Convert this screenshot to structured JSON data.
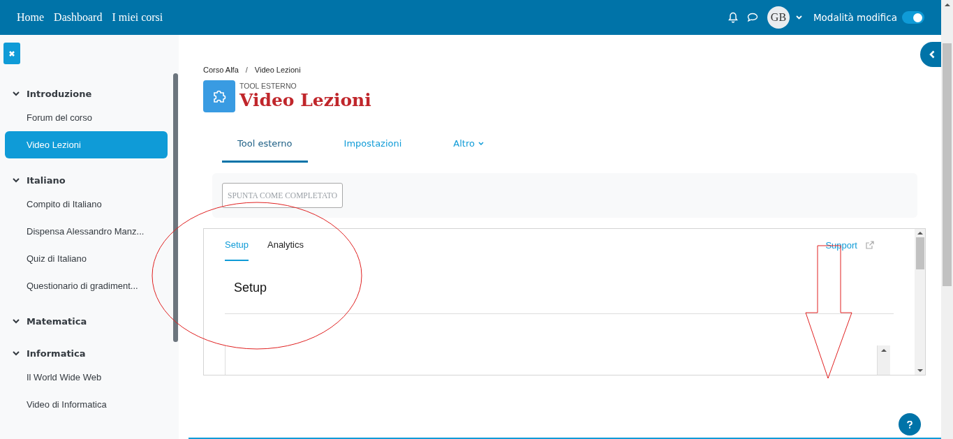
{
  "navbar": {
    "links": [
      {
        "label": "Home"
      },
      {
        "label": "Dashboard"
      },
      {
        "label": "I miei corsi"
      }
    ],
    "avatar": "GB",
    "edit_mode": {
      "label": "Modalità modifica",
      "on": true
    }
  },
  "sidebar": {
    "sections": [
      {
        "title": "Introduzione",
        "expanded": true,
        "items": [
          {
            "label": "Forum del corso",
            "selected": false
          },
          {
            "label": "Video Lezioni",
            "selected": true
          }
        ]
      },
      {
        "title": "Italiano",
        "expanded": true,
        "items": [
          {
            "label": "Compito di Italiano",
            "selected": false
          },
          {
            "label": "Dispensa Alessandro Manz...",
            "selected": false
          },
          {
            "label": "Quiz di Italiano",
            "selected": false
          },
          {
            "label": "Questionario di gradiment...",
            "selected": false
          }
        ]
      },
      {
        "title": "Matematica",
        "expanded": true
      },
      {
        "title": "Informatica",
        "expanded": true,
        "items": [
          {
            "label": "Il World Wide Web",
            "selected": false
          },
          {
            "label": "Video di Informatica",
            "selected": false
          }
        ]
      }
    ]
  },
  "breadcrumb": {
    "links": [
      "Corso Alfa",
      "Video Lezioni"
    ],
    "separator": "/"
  },
  "header": {
    "kind_label": "TOOL ESTERNO",
    "title": "Video Lezioni"
  },
  "tabs": [
    {
      "label": "Tool esterno",
      "selected": true,
      "has_menu": false
    },
    {
      "label": "Impostazioni",
      "selected": false,
      "has_menu": false
    },
    {
      "label": "Altro",
      "selected": false,
      "has_menu": true
    }
  ],
  "completion_button": {
    "label": "SPUNTA COME COMPLETATO",
    "disabled": true
  },
  "frame": {
    "tabs": [
      {
        "label": "Setup",
        "selected": true
      },
      {
        "label": "Analytics",
        "selected": false
      }
    ],
    "support_link": "Support",
    "heading": "Setup"
  }
}
